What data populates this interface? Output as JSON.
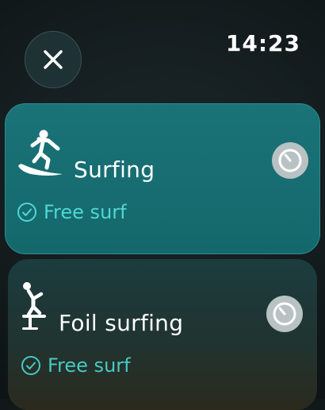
{
  "status": {
    "time": "14:23"
  },
  "close_icon": "close-icon",
  "activities": [
    {
      "title": "Surfing",
      "subtitle": "Free surf",
      "icon": "surfing-icon",
      "status_icon": "check-circle-icon",
      "action_icon": "timer-icon",
      "accent": "#1a7377"
    },
    {
      "title": "Foil surfing",
      "subtitle": "Free surf",
      "icon": "foil-surfing-icon",
      "status_icon": "check-circle-icon",
      "action_icon": "timer-icon"
    }
  ],
  "colors": {
    "accent_text": "#4fd8d2",
    "card_selected": "#1a7377"
  }
}
